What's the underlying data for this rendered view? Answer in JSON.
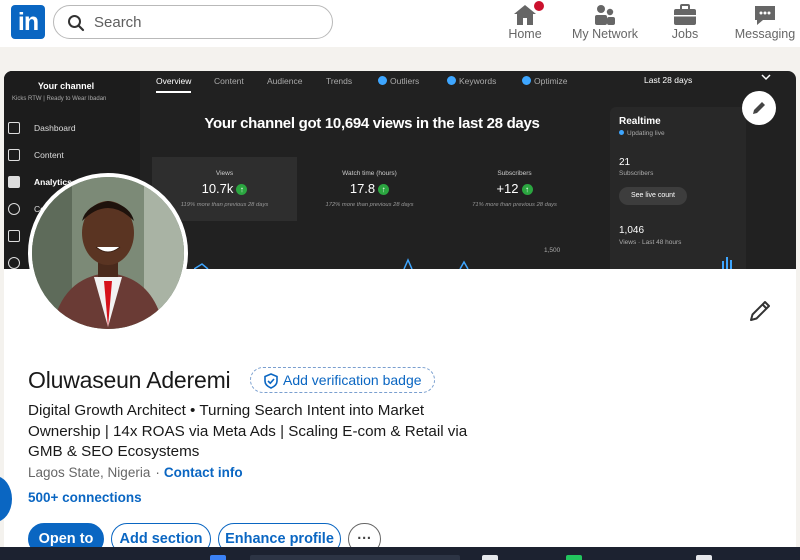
{
  "nav": {
    "logo_text": "in",
    "search_placeholder": "Search",
    "items": [
      {
        "label": "Home",
        "icon": "home-icon"
      },
      {
        "label": "My Network",
        "icon": "people-icon"
      },
      {
        "label": "Jobs",
        "icon": "briefcase-icon"
      },
      {
        "label": "Messaging",
        "icon": "chat-icon"
      }
    ]
  },
  "banner": {
    "channel_title": "Your channel",
    "channel_subtitle": "Kicks RTW | Ready to Wear Ibadan",
    "sidebar": [
      "Dashboard",
      "Content",
      "Analytics",
      "Co"
    ],
    "tabs": [
      "Overview",
      "Content",
      "Audience",
      "Trends",
      "Outliers",
      "Keywords",
      "Optimize"
    ],
    "range": "Last 28 days",
    "headline": "Your channel got 10,694 views in the last 28 days",
    "stats": [
      {
        "label": "Views",
        "value": "10.7k",
        "compare": "119% more than previous 28 days"
      },
      {
        "label": "Watch time (hours)",
        "value": "17.8",
        "compare": "172% more than previous 28 days"
      },
      {
        "label": "Subscribers",
        "value": "+12",
        "compare": "71% more than previous 28 days"
      }
    ],
    "axis_label": "1,500",
    "realtime": {
      "title": "Realtime",
      "status": "Updating live",
      "subs_value": "21",
      "subs_label": "Subscribers",
      "button": "See live count",
      "views_value": "1,046",
      "views_label": "Views · Last 48 hours"
    }
  },
  "profile": {
    "name": "Oluwaseun Aderemi",
    "verification": "Add verification badge",
    "headline": "Digital Growth Architect • Turning Search Intent into Market Ownership | 14x ROAS via Meta Ads | Scaling E-com & Retail via GMB & SEO Ecosystems",
    "location": "Lagos State, Nigeria",
    "contact": "Contact info",
    "connections": "500+ connections",
    "buttons": {
      "open_to": "Open to",
      "add_section": "Add section",
      "enhance": "Enhance profile",
      "more": "···"
    }
  },
  "colors": {
    "brand": "#0a66c2",
    "notification": "#cb112d",
    "banner_bg": "#212121"
  }
}
